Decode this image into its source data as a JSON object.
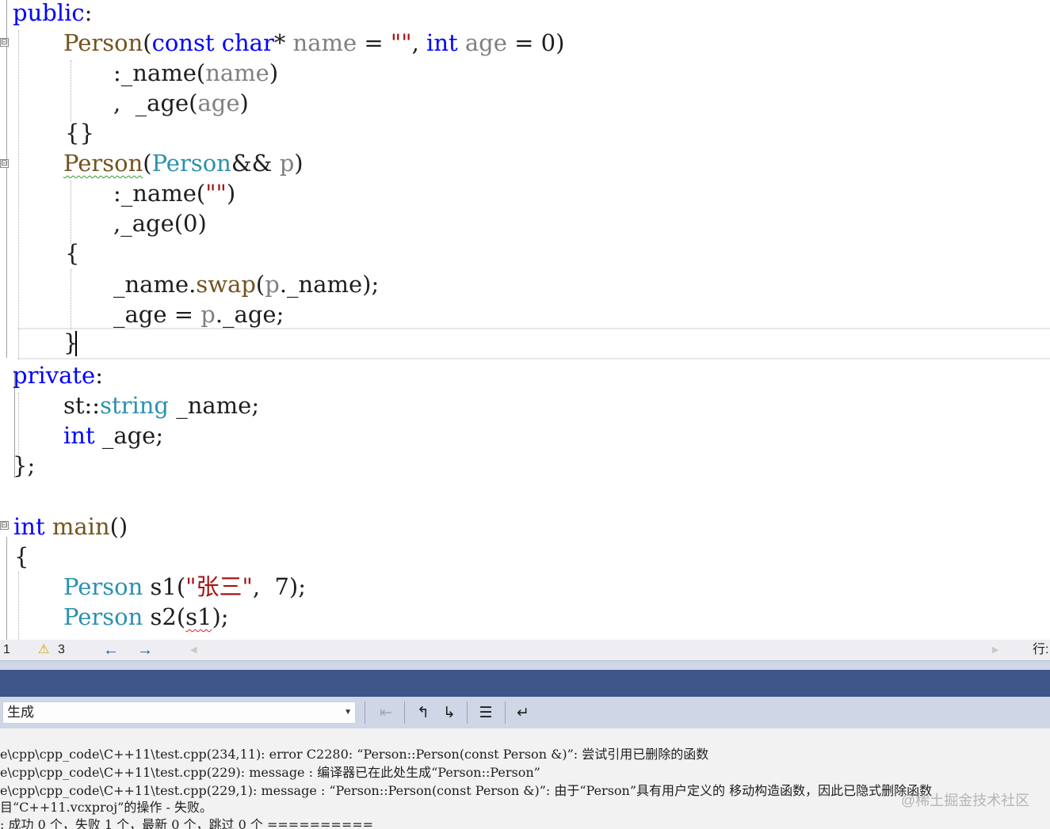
{
  "editor": {
    "lines": {
      "l1": [
        "public",
        ":"
      ],
      "l2": [
        "Person",
        "(",
        "const",
        " ",
        "char",
        "* ",
        "name",
        " = ",
        "\"\"",
        ", ",
        "int",
        " ",
        "age",
        " = 0)"
      ],
      "l3": [
        ":_name(",
        "name",
        ")"
      ],
      "l4": [
        ",  _age(",
        "age",
        ")"
      ],
      "l5": [
        "{}"
      ],
      "l6": [
        "Person",
        "(",
        "Person",
        "&& ",
        "p",
        ")"
      ],
      "l7": [
        ":_name(",
        "\"\"",
        ")"
      ],
      "l8": [
        ",_age(0)"
      ],
      "l9": [
        "{"
      ],
      "l10": [
        "_name.",
        "swap",
        "(",
        "p",
        "._name);"
      ],
      "l11": [
        "_age = ",
        "p",
        "._age;"
      ],
      "l12": [
        "}"
      ],
      "l13": [
        "private",
        ":"
      ],
      "l14": [
        "st::",
        "string",
        " _name;"
      ],
      "l15": [
        "int",
        " _age;"
      ],
      "l16": [
        "};"
      ],
      "l17": [
        "int",
        " ",
        "main",
        "()"
      ],
      "l18": [
        "{"
      ],
      "l19": [
        "Person",
        " s1(",
        "\"张三\"",
        ",  7);"
      ],
      "l20": [
        "Person",
        " s2(",
        "s1",
        ");"
      ]
    },
    "fold_icon": "⊟",
    "theme": {
      "keyword": "#0000ff",
      "type": "#2b91af",
      "function": "#74531f",
      "parameter": "#808080",
      "string": "#a31515",
      "squiggle_warning": "#2e9b2e",
      "squiggle_error": "#e02020"
    }
  },
  "statusbar": {
    "errors_count": "1",
    "warning_icon": "⚠",
    "warnings_count": "3",
    "nav_back_icon": "←",
    "nav_forward_icon": "→",
    "line_label": "行:"
  },
  "output_panel": {
    "title_bar_color": "#3f568b",
    "source_selector": {
      "value": "生成"
    },
    "toolbar_icons": [
      "find-message-icon",
      "prev-message-icon",
      "next-message-icon",
      "clear-all-icon",
      "word-wrap-icon"
    ],
    "lines": [
      "e\\cpp\\cpp_code\\C++11\\test.cpp(234,11): error C2280: “Person::Person(const Person &)”: 尝试引用已删除的函数",
      "e\\cpp\\cpp_code\\C++11\\test.cpp(229): message : 编译器已在此处生成“Person::Person”",
      "e\\cpp\\cpp_code\\C++11\\test.cpp(229,1): message : “Person::Person(const Person &)”: 由于“Person”具有用户定义的 移动构造函数，因此已隐式删除函数",
      "目“C++11.vcxproj”的操作 - 失败。",
      ": 成功 0 个，失败 1 个，最新 0 个，跳过 0 个 =========="
    ]
  },
  "watermark": "@稀土掘金技术社区"
}
